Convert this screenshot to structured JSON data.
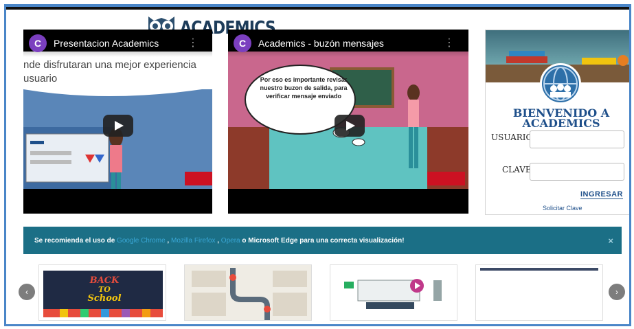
{
  "logo": {
    "text": "ACADEMICS",
    "icon": "owl-logo-icon"
  },
  "videos": [
    {
      "channel_initial": "C",
      "title": "Presentacion Academics",
      "caption": "nde disfrutaran una mejor experiencia usuario"
    },
    {
      "channel_initial": "C",
      "title": "Academics - buzón mensajes",
      "bubble": "Por eso es importante revisar nuestro buzon de salida, para verificar mensaje enviado"
    }
  ],
  "login": {
    "welcome_line1": "BIENVENIDO A",
    "welcome_line2": "ACADEMICS",
    "user_label": "USUARIO",
    "pass_label": "CLAVE",
    "user_value": "",
    "pass_value": "",
    "submit": "INGRESAR",
    "request_link": "Solicitar Clave"
  },
  "alert": {
    "prefix": "Se recomienda el uso de",
    "browser1": "Google Chrome",
    "sep1": ",",
    "browser2": "Mozilla Firefox",
    "sep2": ",",
    "browser3": "Opera",
    "suffix": "o Microsoft Edge para una correcta visualización!",
    "close": "×"
  },
  "carousel": {
    "prev": "‹",
    "next": "›",
    "items": [
      {
        "name": "back-to-school",
        "text_line1": "BACK",
        "text_line2": "TO",
        "text_line3": "School"
      },
      {
        "name": "map"
      },
      {
        "name": "online-tools"
      },
      {
        "name": "blank-slide"
      }
    ]
  },
  "colors": {
    "frame": "#4a86c8",
    "alert_bg": "#1b6f86",
    "brand": "#1e4f8a",
    "channel": "#7b3fbf"
  }
}
